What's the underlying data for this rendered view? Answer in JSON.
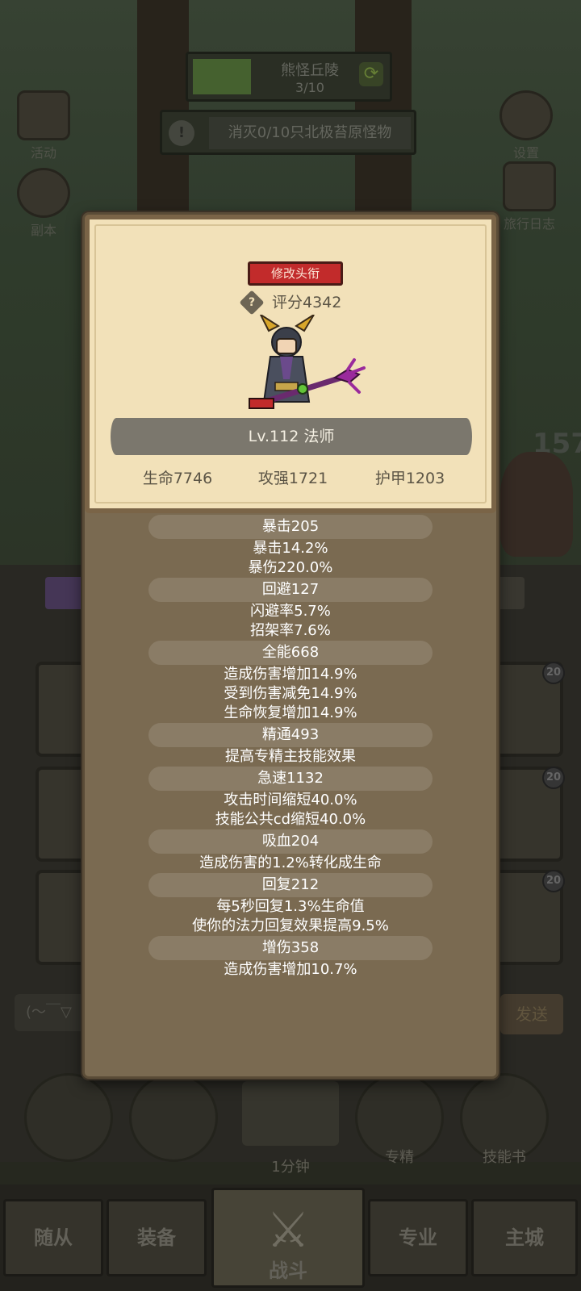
{
  "background": {
    "stage_title": "熊怪丘陵",
    "stage_progress": "3/10",
    "quest_text": "消灭0/10只北极苔原怪物",
    "quest_icon": "!",
    "left_buttons": [
      {
        "label": "活动",
        "icon": "event-scroll-icon"
      },
      {
        "label": "副本",
        "icon": "dungeon-portal-icon"
      }
    ],
    "right_buttons": [
      {
        "label": "设置",
        "icon": "gear-icon"
      },
      {
        "label": "旅行日志",
        "icon": "journal-book-icon"
      }
    ],
    "damage_number": "157",
    "card_badges": [
      "20",
      "20",
      "20"
    ],
    "chat_text": "(～￣▽",
    "send_label": "发送",
    "action_buttons": [
      {
        "label": "",
        "icon": "potion-icon"
      },
      {
        "label": "",
        "icon": "bread-icon"
      },
      {
        "label": "专精",
        "icon": "mastery-shield-icon"
      },
      {
        "label": "技能书",
        "icon": "skill-book-icon"
      }
    ],
    "chest_timer": "1分钟",
    "chest_badge": "!"
  },
  "nav": {
    "tabs": [
      "随从",
      "装备",
      "战斗",
      "专业",
      "主城"
    ],
    "active": "战斗"
  },
  "panel": {
    "title_button": "修改头衔",
    "score": "评分4342",
    "help_icon": "?",
    "level_class": "Lv.112 法师",
    "main_stats": [
      "生命7746",
      "攻强1721",
      "护甲1203"
    ],
    "stat_groups": [
      {
        "header": "暴击205",
        "lines": [
          "暴击14.2%",
          "暴伤220.0%"
        ]
      },
      {
        "header": "回避127",
        "lines": [
          "闪避率5.7%",
          "招架率7.6%"
        ]
      },
      {
        "header": "全能668",
        "lines": [
          "造成伤害增加14.9%",
          "受到伤害减免14.9%",
          "生命恢复增加14.9%"
        ]
      },
      {
        "header": "精通493",
        "lines": [
          "提高专精主技能效果"
        ]
      },
      {
        "header": "急速1132",
        "lines": [
          "攻击时间缩短40.0%",
          "技能公共cd缩短40.0%"
        ]
      },
      {
        "header": "吸血204",
        "lines": [
          "造成伤害的1.2%转化成生命"
        ]
      },
      {
        "header": "回复212",
        "lines": [
          "每5秒回复1.3%生命值",
          "使你的法力回复效果提高9.5%"
        ]
      },
      {
        "header": "增伤358",
        "lines": [
          "造成伤害增加10.7%"
        ]
      }
    ]
  },
  "colors": {
    "title_button_bg": "#c22b2b",
    "card_bg": "#f2e1b9",
    "panel_bg": "#7a6a51",
    "stat_header_bg": "#8a7c66"
  }
}
